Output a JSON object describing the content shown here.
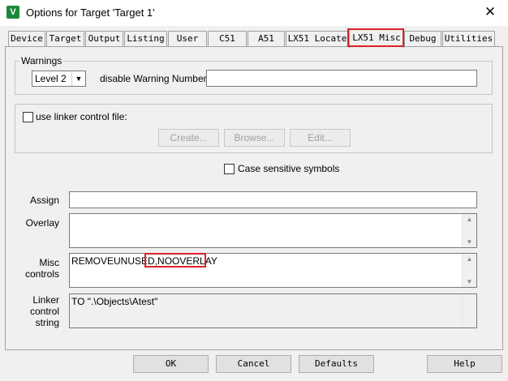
{
  "window": {
    "title": "Options for Target 'Target 1'",
    "app_icon_glyph": "V",
    "close_glyph": "✕"
  },
  "tabs": [
    {
      "label": "Device"
    },
    {
      "label": "Target"
    },
    {
      "label": "Output"
    },
    {
      "label": "Listing"
    },
    {
      "label": "User"
    },
    {
      "label": "C51"
    },
    {
      "label": "A51"
    },
    {
      "label": "LX51 Locate"
    },
    {
      "label": "LX51 Misc",
      "active": true
    },
    {
      "label": "Debug"
    },
    {
      "label": "Utilities"
    }
  ],
  "warnings": {
    "group_label": "Warnings",
    "level_value": "Level 2",
    "disable_label": "disable Warning Numbers:",
    "disable_value": ""
  },
  "linker_file": {
    "checkbox_label": "use linker control file:",
    "checked": false,
    "create_label": "Create...",
    "browse_label": "Browse...",
    "edit_label": "Edit..."
  },
  "case_sensitive": {
    "label": "Case sensitive symbols",
    "checked": false
  },
  "fields": {
    "assign_label": "Assign",
    "assign_value": "",
    "overlay_label": "Overlay",
    "overlay_value": "",
    "misc_label_1": "Misc",
    "misc_label_2": "controls",
    "misc_value_a": "REMOVEUNUSED",
    "misc_value_b": ",NOOVERLAY",
    "linker_label_1": "Linker",
    "linker_label_2": "control",
    "linker_label_3": "string",
    "linker_value": "TO \".\\Objects\\Atest\""
  },
  "footer": {
    "ok": "OK",
    "cancel": "Cancel",
    "defaults": "Defaults",
    "help": "Help"
  },
  "icons": {
    "scroll_up": "▲",
    "scroll_down": "▼",
    "dropdown": "▼"
  },
  "colors": {
    "highlight": "#d9222a",
    "app_icon": "#1a8a3a"
  }
}
